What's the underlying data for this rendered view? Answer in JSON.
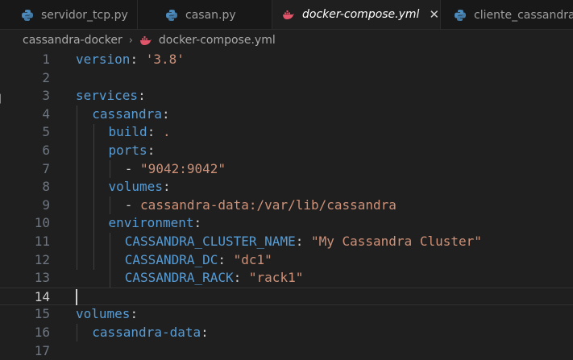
{
  "tabs": [
    {
      "label": "servidor_tcp.py",
      "icon": "python-icon"
    },
    {
      "label": "casan.py",
      "icon": "python-icon"
    },
    {
      "label": "docker-compose.yml",
      "icon": "docker-icon",
      "close": "✕"
    },
    {
      "label": "cliente_cassandra",
      "icon": "python-icon"
    }
  ],
  "breadcrumb": {
    "folder": "cassandra-docker",
    "separator": "›",
    "file": "docker-compose.yml"
  },
  "editor": {
    "line_numbers": [
      "1",
      "2",
      "3",
      "4",
      "5",
      "6",
      "7",
      "8",
      "9",
      "10",
      "11",
      "12",
      "13",
      "14",
      "15",
      "16",
      "17"
    ],
    "current_line": 14,
    "lines": [
      {
        "key": "version",
        "punct": ": ",
        "value": "'3.8'"
      },
      {},
      {
        "key": "services",
        "punct": ":"
      },
      {
        "key": "cassandra",
        "punct": ":"
      },
      {
        "key": "build",
        "punct": ": ",
        "value": "."
      },
      {
        "key": "ports",
        "punct": ":"
      },
      {
        "dash": "- ",
        "value": "\"9042:9042\""
      },
      {
        "key": "volumes",
        "punct": ":"
      },
      {
        "dash": "- ",
        "value": "cassandra-data:/var/lib/cassandra"
      },
      {
        "key": "environment",
        "punct": ":"
      },
      {
        "key": "CASSANDRA_CLUSTER_NAME",
        "punct": ": ",
        "value": "\"My Cassandra Cluster\""
      },
      {
        "key": "CASSANDRA_DC",
        "punct": ": ",
        "value": "\"dc1\""
      },
      {
        "key": "CASSANDRA_RACK",
        "punct": ": ",
        "value": "\"rack1\""
      },
      {},
      {
        "key": "volumes",
        "punct": ":"
      },
      {
        "key": "cassandra-data",
        "punct": ":"
      },
      {}
    ]
  },
  "colors": {
    "keyword": "#569cd6",
    "string": "#ce9178",
    "background": "#1f1f1f"
  }
}
